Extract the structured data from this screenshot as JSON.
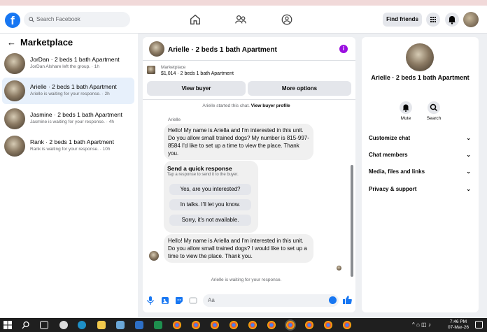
{
  "header": {
    "search_placeholder": "Search Facebook",
    "find_friends": "Find friends"
  },
  "sidebar": {
    "title": "Marketplace",
    "items": [
      {
        "title": "JorDan · 2 beds 1 bath Apartment",
        "subtitle": "JorDan Alshare left the group. · 1h"
      },
      {
        "title": "Arielle · 2 beds 1 bath Apartment",
        "subtitle": "Arielle is waiting for your response. · 2h"
      },
      {
        "title": "Jasmine · 2 beds 1 bath Apartment",
        "subtitle": "Jasmine is waiting for your response. · 4h"
      },
      {
        "title": "Rank · 2 beds 1 bath Apartment",
        "subtitle": "Rank is waiting for your response. · 10h"
      }
    ]
  },
  "chat": {
    "title": "Arielle · 2 beds 1 bath Apartment",
    "listing_label": "Marketplace",
    "listing_detail": "$1,014 · 2 beds 1 bath Apartment",
    "view_buyer": "View buyer",
    "more_options": "More options",
    "started_text": "Arielle started this chat.",
    "view_profile": "View buyer profile",
    "sender_name": "Arielle",
    "message1": "Hello! My name is Ariella and I'm interested in this unit. Do you allow small trained dogs? My number is 815-997-8584 I'd like to set up a time to view the place. Thank you.",
    "quick_title": "Send a quick response",
    "quick_sub": "Tap a response to send it to the buyer.",
    "quick_responses": [
      "Yes, are you interested?",
      "In talks. I'll let you know.",
      "Sorry, it's not available."
    ],
    "message2": "Hello! My name is Ariella and I'm interested in this unit. Do you allow small trained dogs? I would like to set up a time to view the place. Thank you.",
    "waiting": "Arielle is waiting for your response.",
    "composer_placeholder": "Aa"
  },
  "details": {
    "name": "Arielle · 2 beds 1 bath Apartment",
    "mute": "Mute",
    "search": "Search",
    "rows": [
      "Customize chat",
      "Chat members",
      "Media, files and links",
      "Privacy & support"
    ]
  },
  "taskbar": {
    "time": "7:46 PM",
    "date": "07-Mar-26"
  },
  "colors": {
    "brand": "#1877f2",
    "accent_purple": "#9a0fe0"
  }
}
